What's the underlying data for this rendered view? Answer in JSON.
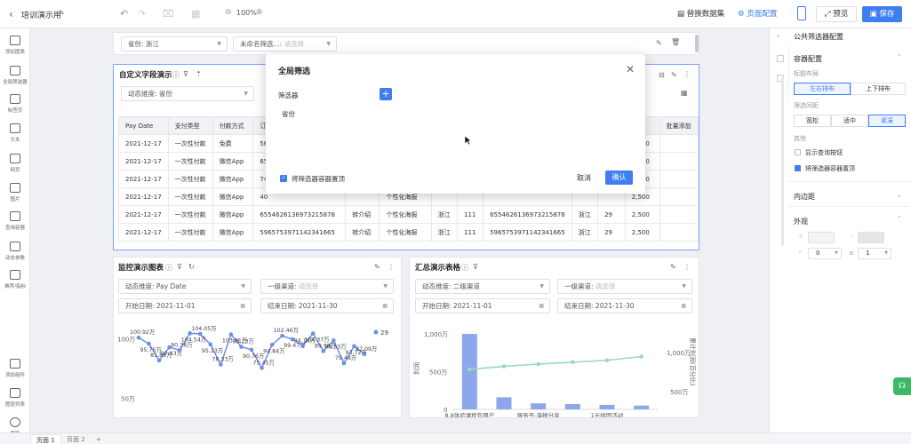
{
  "topbar": {
    "back_icon": "chevron-left-icon",
    "title": "培训演示用",
    "edit_icon": "pencil-icon",
    "zoom": "100%",
    "replace_data": "替换数据集",
    "page_config": "页面配置",
    "preview": "预览",
    "save": "保存"
  },
  "leftbar": {
    "items": [
      {
        "label": "添加图表",
        "icon": "chart-icon"
      },
      {
        "label": "全局筛选器",
        "icon": "filter-icon"
      },
      {
        "label": "标签页",
        "icon": "tabs-icon"
      },
      {
        "label": "文本",
        "icon": "text-icon"
      },
      {
        "label": "网页",
        "icon": "webpage-icon"
      },
      {
        "label": "图片",
        "icon": "image-icon"
      },
      {
        "label": "查询容器",
        "icon": "search-container-icon"
      },
      {
        "label": "动态参数",
        "icon": "sliders-icon"
      },
      {
        "label": "推荐/指标",
        "icon": "metric-icon"
      },
      {
        "label": "添加组件",
        "icon": "add-component-icon"
      },
      {
        "label": "图层列表",
        "icon": "layers-icon"
      },
      {
        "label": "帮助",
        "icon": "help-icon"
      }
    ]
  },
  "global_filter_bar": {
    "filter1_label": "省份",
    "filter1_value": "浙江",
    "filter2_label": "未命名筛选...",
    "filter2_placeholder": "请选择"
  },
  "table_panel": {
    "title": "自定义字段演示",
    "dim_label": "动态维度",
    "dim_value": "省份",
    "columns": [
      "Pay Date",
      "支付类型",
      "付款方式",
      "订"
    ],
    "right_columns": [
      "单价",
      "批量添加"
    ],
    "rows": [
      [
        "2021-12-17",
        "一次性付款",
        "免费",
        "56"
      ],
      [
        "2021-12-17",
        "一次性付款",
        "微信App",
        "65"
      ],
      [
        "2021-12-17",
        "一次性付款",
        "微信App",
        "74"
      ],
      [
        "2021-12-17",
        "一次性付款",
        "微信App",
        "40"
      ],
      [
        "2021-12-17",
        "一次性付款",
        "微信App",
        "6554626136973215878"
      ],
      [
        "2021-12-17",
        "一次性付款",
        "微信App",
        "5965753971142341665"
      ]
    ],
    "row_extra": [
      [
        "",
        "",
        "",
        "",
        "",
        "",
        "",
        "2,500"
      ],
      [
        "",
        "",
        "",
        "",
        "",
        "",
        "",
        "2,500"
      ],
      [
        "",
        "",
        "",
        "",
        "",
        "",
        "",
        "2,500"
      ],
      [
        "",
        "",
        "",
        "",
        "",
        "",
        "",
        "2,500"
      ],
      [
        "转介绍",
        "个性化海报",
        "浙江",
        "111",
        "6554626136973215878",
        "浙江",
        "29",
        "2,500"
      ],
      [
        "转介绍",
        "个性化海报",
        "浙江",
        "111",
        "5965753971142341665",
        "浙江",
        "29",
        "2,500"
      ]
    ],
    "row4_partial": [
      "个性化海报"
    ]
  },
  "modal": {
    "title": "全局筛选",
    "filter_label": "筛选器",
    "add_label": "+",
    "item": "省份",
    "pin_label": "将筛选器容器置顶",
    "cancel": "取消",
    "confirm": "确认"
  },
  "monitor_panel": {
    "title": "监控演示图表",
    "dim_label": "动态维度",
    "dim_value": "Pay Date",
    "channel_label": "一级渠道",
    "channel_placeholder": "请选择",
    "start_label": "开始日期",
    "start_value": "2021-11-01",
    "end_label": "结束日期",
    "end_value": "2021-11-30"
  },
  "summary_panel": {
    "title": "汇总演示表格",
    "dim_label": "动态维度",
    "dim_value": "二级渠道",
    "channel_label": "一级渠道",
    "channel_placeholder": "请选择",
    "start_label": "开始日期",
    "start_value": "2021-11-01",
    "end_label": "结束日期",
    "end_value": "2021-11-30"
  },
  "chart_data": [
    {
      "type": "line",
      "ylabel": "",
      "ytick_labels": [
        "100万",
        "50万"
      ],
      "legend": [
        "29"
      ],
      "series": [
        {
          "name": "29",
          "values": [
            100.92,
            95.75,
            81.81,
            92.83,
            90.38,
            104.54,
            104.05,
            95.23,
            78.33,
            103.61,
            93.23,
            90.76,
            75.45,
            94.84,
            102.46,
            99.47,
            94.16,
            104.37,
            89.58,
            98.53,
            79.48,
            93.72,
            87.09
          ]
        }
      ],
      "data_labels": [
        "100.92万",
        "95.75万",
        "81.81万",
        "92.83万",
        "90.38万",
        "104.54万",
        "104.05万",
        "95.23万",
        "78.33万",
        "103.61万",
        "93.23万",
        "90.76万",
        "75.45万",
        "94.84万",
        "102.46万",
        "99.47万",
        "94.16万",
        "104.37万",
        "89.58万",
        "98.53万",
        "79.48万",
        "93.72万",
        "87.09万"
      ],
      "color": "#6b8ee6"
    },
    {
      "type": "bar",
      "ylabel": "利润",
      "y2label": "累计利润(百分比)",
      "ytick_labels": [
        "1,000万",
        "500万",
        "0"
      ],
      "y2tick_labels": [
        "1,000万",
        "500万"
      ],
      "categories": [
        "8.8体验课程包用户",
        "",
        "服务号-海报分享",
        "",
        "1元拼团活动",
        ""
      ],
      "values": [
        1000,
        160,
        80,
        70,
        60,
        50
      ],
      "line_values": [
        530,
        570,
        600,
        625,
        650,
        700
      ],
      "ylim": [
        0,
        1000
      ],
      "bar_color": "#8ea7ea",
      "line_color": "#9bd8bd"
    }
  ],
  "right_panel": {
    "title": "公共筛选器配置",
    "container_config": "容器配置",
    "layout_label": "标题布局",
    "layout_left": "左右排布",
    "layout_top": "上下排布",
    "spacing_label": "筛选间距",
    "spacing_loose": "宽松",
    "spacing_mid": "适中",
    "spacing_tight": "紧凑",
    "other_label": "其他",
    "show_query": "显示查询按钮",
    "pin_container": "将筛选器容器置顶",
    "padding": "内边距",
    "appearance": "外观",
    "radius_value": "0",
    "border_value": "1"
  },
  "bottom": {
    "tab1": "页面 1",
    "tab2": "页面 2",
    "add": "+"
  }
}
